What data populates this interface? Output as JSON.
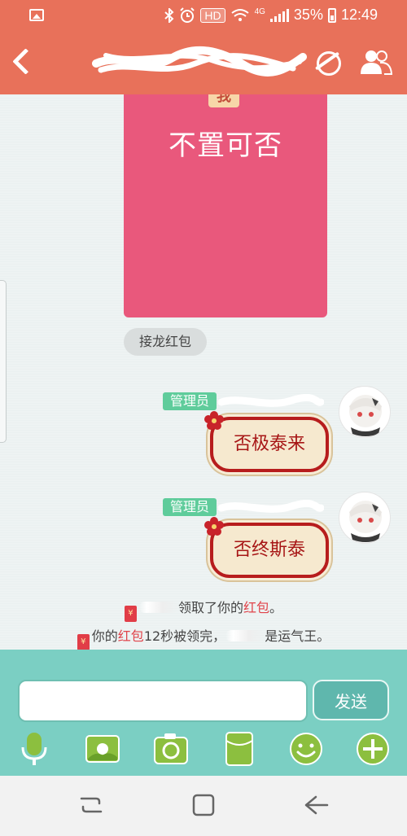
{
  "status_bar": {
    "hd_badge": "HD",
    "network": "4G",
    "battery": "35%",
    "time": "12:49"
  },
  "card": {
    "tab_glyph": "我",
    "text": "不置可否"
  },
  "relay_chip": "接龙红包",
  "messages": [
    {
      "role_tag": "管理员",
      "text": "否极泰来"
    },
    {
      "role_tag": "管理员",
      "text": "否终斯泰"
    }
  ],
  "system": {
    "line1_mid": "领取了你的",
    "line1_red": "红包",
    "line1_end": "。",
    "line2_start": "你的",
    "line2_red": "红包",
    "line2_mid": "12秒被领完，",
    "line2_end": "是运气王。",
    "envelope_glyph": "¥"
  },
  "composer": {
    "input_value": "",
    "send_label": "发送"
  },
  "toolbar_icons": [
    "microphone-icon",
    "picture-icon",
    "camera-icon",
    "red-envelope-icon",
    "emoji-icon",
    "plus-icon"
  ],
  "colors": {
    "header": "#e8715a",
    "card": "#e9587c",
    "admin_tag": "#5fcc9b",
    "toolbar": "#7bcfc3",
    "icon_green": "#8cbf3f"
  }
}
